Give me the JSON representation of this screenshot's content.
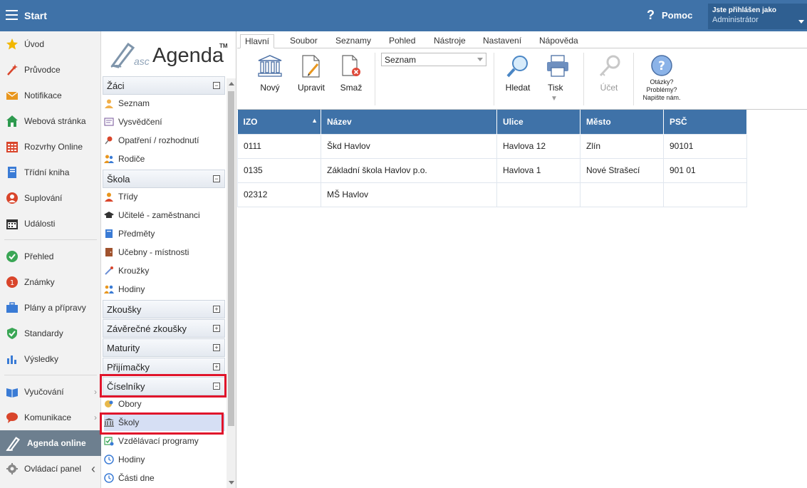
{
  "topbar": {
    "start_label": "Start",
    "help_label": "Pomoc",
    "user_title": "Jste přihlášen jako",
    "user_name": "Administrátor"
  },
  "leftnav": {
    "items": [
      {
        "label": "Úvod",
        "icon": "star-icon",
        "color": "#f2b700"
      },
      {
        "label": "Průvodce",
        "icon": "wand-icon",
        "color": "#d9452b"
      },
      {
        "label": "Notifikace",
        "icon": "envelope-icon",
        "color": "#e8961e"
      },
      {
        "label": "Webová stránka",
        "icon": "house-icon",
        "color": "#2e9a4f"
      },
      {
        "label": "Rozvrhy Online",
        "icon": "timetable-icon",
        "color": "#d9452b"
      },
      {
        "label": "Třídní kniha",
        "icon": "book-icon",
        "color": "#3a7bd5"
      },
      {
        "label": "Suplování",
        "icon": "person-icon",
        "color": "#d9452b"
      },
      {
        "label": "Události",
        "icon": "calendar-icon",
        "color": "#333333"
      },
      {
        "label": "Přehled",
        "icon": "check-circle-icon",
        "color": "#3aa655"
      },
      {
        "label": "Známky",
        "icon": "grade-icon",
        "color": "#d9452b"
      },
      {
        "label": "Plány a přípravy",
        "icon": "briefcase-icon",
        "color": "#3a7bd5"
      },
      {
        "label": "Standardy",
        "icon": "shield-icon",
        "color": "#3aa655"
      },
      {
        "label": "Výsledky",
        "icon": "bar-chart-icon",
        "color": "#3a7bd5"
      },
      {
        "label": "Vyučování",
        "icon": "open-book-icon",
        "color": "#3a7bd5"
      },
      {
        "label": "Komunikace",
        "icon": "chat-icon",
        "color": "#d9452b"
      },
      {
        "label": "Agenda online",
        "icon": "agenda-icon",
        "color": "#ffffff"
      },
      {
        "label": "Ovládací panel",
        "icon": "gear-icon",
        "color": "#888888"
      }
    ]
  },
  "logo": {
    "asc": "asc",
    "main": "Agenda",
    "tm": "TM"
  },
  "panel": {
    "zaci": {
      "title": "Žáci",
      "toggle": "−",
      "items": [
        "Seznam",
        "Vysvědčení",
        "Opatření / rozhodnutí",
        "Rodiče"
      ]
    },
    "skola": {
      "title": "Škola",
      "toggle": "−",
      "items": [
        "Třídy",
        "Učitelé - zaměstnanci",
        "Předměty",
        "Učebny - místnosti",
        "Kroužky",
        "Hodiny"
      ]
    },
    "zkousky": {
      "title": "Zkoušky",
      "toggle": "+"
    },
    "zaverecne": {
      "title": "Závěrečné zkoušky",
      "toggle": "+"
    },
    "maturity": {
      "title": "Maturity",
      "toggle": "+"
    },
    "prijimacky": {
      "title": "Přijímačky",
      "toggle": "+"
    },
    "ciselniky": {
      "title": "Číselníky",
      "toggle": "−",
      "items": [
        "Obory",
        "Školy",
        "Vzdělávací programy",
        "Hodiny",
        "Části dne"
      ]
    }
  },
  "ribbon": {
    "tabs": [
      "Hlavní",
      "Soubor",
      "Seznamy",
      "Pohled",
      "Nástroje",
      "Nastavení",
      "Nápověda"
    ],
    "view_select": "Seznam",
    "buttons": {
      "new": "Nový",
      "edit": "Upravit",
      "delete": "Smaž",
      "find": "Hledat",
      "print": "Tisk",
      "account": "Účet"
    },
    "help_text": {
      "line1": "Otázky?",
      "line2": "Problémy?",
      "line3": "Napište nám."
    }
  },
  "table": {
    "columns": [
      "IZO",
      "Název",
      "Ulice",
      "Město",
      "PSČ"
    ],
    "rows": [
      [
        "0111",
        "Škd Havlov",
        "Havlova 12",
        "Zlín",
        "90101"
      ],
      [
        "0135",
        "Základní škola Havlov p.o.",
        "Havlova 1",
        "Nové Strašecí",
        "901 01"
      ],
      [
        "02312",
        "MŠ Havlov",
        "",
        "",
        ""
      ]
    ]
  }
}
